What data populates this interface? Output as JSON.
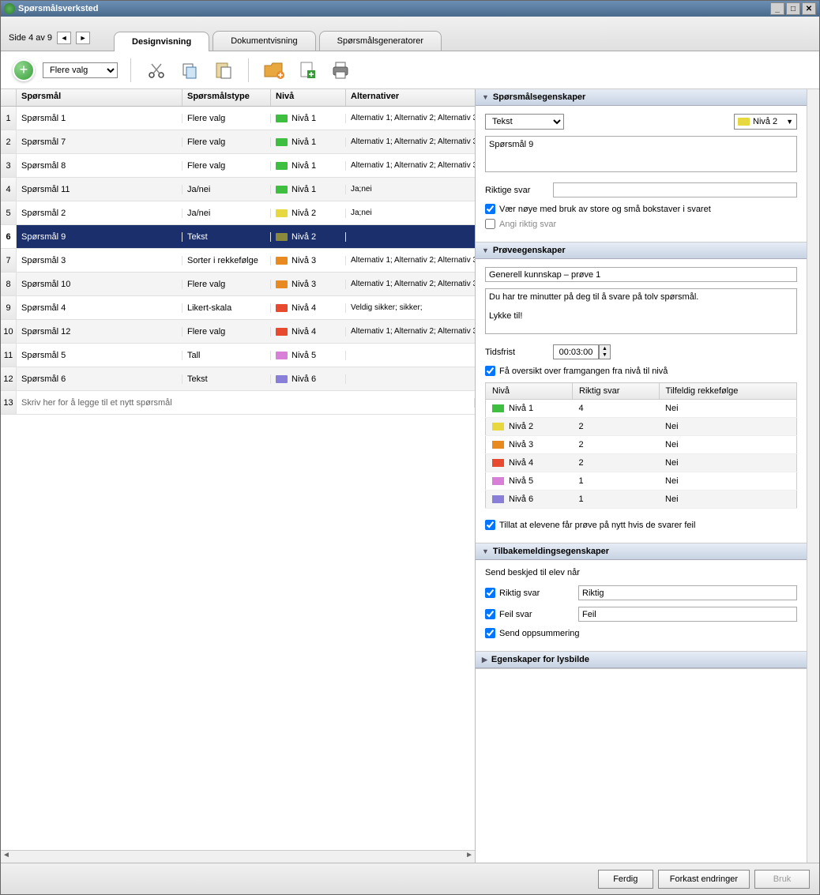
{
  "window_title": "Spørsmålsverksted",
  "page_label": "Side 4 av 9",
  "tabs": [
    "Designvisning",
    "Dokumentvisning",
    "Spørsmålsgeneratorer"
  ],
  "active_tab": 0,
  "combo_value": "Flere valg",
  "columns": [
    "Spørsmål",
    "Spørsmålstype",
    "Nivå",
    "Alternativer"
  ],
  "rows": [
    {
      "n": "1",
      "q": "Spørsmål 1",
      "type": "Flere valg",
      "lvl": "Nivå 1",
      "color": "#3fbf3f",
      "alt": "Alternativ 1; Alternativ 2; Alternativ 3;"
    },
    {
      "n": "2",
      "q": "Spørsmål 7",
      "type": "Flere valg",
      "lvl": "Nivå 1",
      "color": "#3fbf3f",
      "alt": "Alternativ 1; Alternativ 2; Alternativ 3;"
    },
    {
      "n": "3",
      "q": "Spørsmål 8",
      "type": "Flere valg",
      "lvl": "Nivå 1",
      "color": "#3fbf3f",
      "alt": "Alternativ 1; Alternativ 2; Alternativ 3;"
    },
    {
      "n": "4",
      "q": "Spørsmål 11",
      "type": "Ja/nei",
      "lvl": "Nivå 1",
      "color": "#3fbf3f",
      "alt": "Ja;nei"
    },
    {
      "n": "5",
      "q": "Spørsmål 2",
      "type": "Ja/nei",
      "lvl": "Nivå 2",
      "color": "#e8d83f",
      "alt": "Ja;nei"
    },
    {
      "n": "6",
      "q": "Spørsmål 9",
      "type": "Tekst",
      "lvl": "Nivå 2",
      "color": "#8a8a3a",
      "alt": ""
    },
    {
      "n": "7",
      "q": "Spørsmål 3",
      "type": "Sorter i rekkefølge",
      "lvl": "Nivå 3",
      "color": "#e88a1f",
      "alt": "Alternativ 1; Alternativ 2; Alternativ 3;"
    },
    {
      "n": "8",
      "q": "Spørsmål 10",
      "type": "Flere valg",
      "lvl": "Nivå 3",
      "color": "#e88a1f",
      "alt": "Alternativ 1; Alternativ 2; Alternativ 3;"
    },
    {
      "n": "9",
      "q": "Spørsmål 4",
      "type": "Likert-skala",
      "lvl": "Nivå 4",
      "color": "#e84a2f",
      "alt": "Veldig sikker; sikker;"
    },
    {
      "n": "10",
      "q": "Spørsmål 12",
      "type": "Flere valg",
      "lvl": "Nivå 4",
      "color": "#e84a2f",
      "alt": "Alternativ 1; Alternativ 2; Alternativ 3;"
    },
    {
      "n": "11",
      "q": "Spørsmål 5",
      "type": "Tall",
      "lvl": "Nivå 5",
      "color": "#d87fd8",
      "alt": ""
    },
    {
      "n": "12",
      "q": "Spørsmål 6",
      "type": "Tekst",
      "lvl": "Nivå 6",
      "color": "#8a7fd8",
      "alt": ""
    }
  ],
  "selected_row": 5,
  "add_row_text": "Skriv her for å legge til et nytt spørsmål",
  "add_row_n": "13",
  "panels": {
    "props": "Spørsmålsegenskaper",
    "test": "Prøveegenskaper",
    "feedback": "Tilbakemeldingsegenskaper",
    "slide": "Egenskaper for lysbilde"
  },
  "props": {
    "type_value": "Tekst",
    "level_value": "Nivå 2",
    "level_color": "#e8d83f",
    "question_text": "Spørsmål 9",
    "correct_label": "Riktige svar",
    "correct_value": "",
    "case_sensitive": "Vær nøye med bruk av store og små bokstaver i svaret",
    "set_correct": "Angi riktig svar"
  },
  "test": {
    "title": "Generell kunnskap – prøve 1",
    "desc": "Du har tre minutter på deg til å svare på tolv spørsmål.\n\nLykke til!",
    "time_label": "Tidsfrist",
    "time_value": "00:03:00",
    "progress_label": "Få oversikt over framgangen fra nivå til nivå",
    "level_cols": [
      "Nivå",
      "Riktig svar",
      "Tilfeldig rekkefølge"
    ],
    "levels": [
      {
        "color": "#3fbf3f",
        "name": "Nivå 1",
        "correct": "4",
        "random": "Nei"
      },
      {
        "color": "#e8d83f",
        "name": "Nivå 2",
        "correct": "2",
        "random": "Nei"
      },
      {
        "color": "#e88a1f",
        "name": "Nivå 3",
        "correct": "2",
        "random": "Nei"
      },
      {
        "color": "#e84a2f",
        "name": "Nivå 4",
        "correct": "2",
        "random": "Nei"
      },
      {
        "color": "#d87fd8",
        "name": "Nivå 5",
        "correct": "1",
        "random": "Nei"
      },
      {
        "color": "#8a7fd8",
        "name": "Nivå 6",
        "correct": "1",
        "random": "Nei"
      }
    ],
    "retry_label": "Tillat at elevene får prøve på nytt hvis de svarer feil"
  },
  "feedback": {
    "send_label": "Send beskjed til elev når",
    "correct_label": "Riktig svar",
    "correct_value": "Riktig",
    "wrong_label": "Feil svar",
    "wrong_value": "Feil",
    "summary_label": "Send oppsummering"
  },
  "buttons": {
    "done": "Ferdig",
    "discard": "Forkast endringer",
    "apply": "Bruk"
  }
}
